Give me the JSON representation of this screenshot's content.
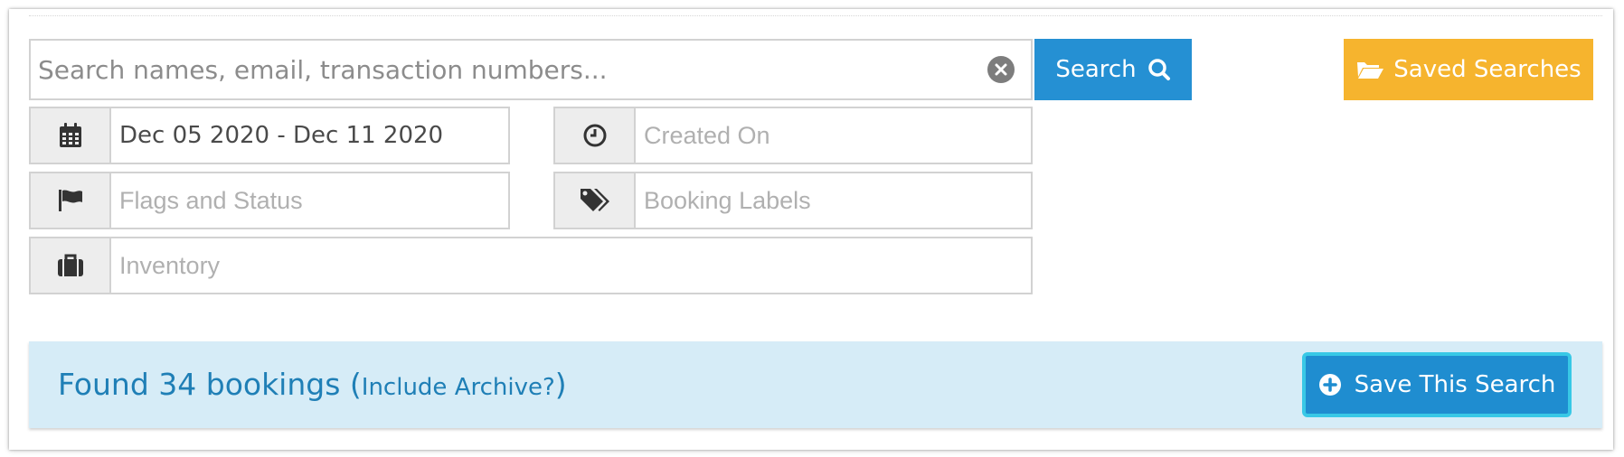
{
  "search": {
    "placeholder": "Search names, email, transaction numbers...",
    "value": "",
    "button_label": "Search"
  },
  "saved_searches": {
    "label": "Saved Searches"
  },
  "filters": {
    "date_range": {
      "icon": "calendar-icon",
      "value": "Dec 05 2020 - Dec 11 2020"
    },
    "created_on": {
      "icon": "clock-icon",
      "placeholder": "Created On"
    },
    "flags_status": {
      "icon": "flag-icon",
      "placeholder": "Flags and Status"
    },
    "booking_labels": {
      "icon": "tags-icon",
      "placeholder": "Booking Labels"
    },
    "inventory": {
      "icon": "briefcase-icon",
      "placeholder": "Inventory"
    }
  },
  "results": {
    "found_text": "Found 34 bookings",
    "open_paren": "(",
    "archive_link": "Include Archive?",
    "close_paren": ")",
    "save_button_label": "Save This Search"
  },
  "colors": {
    "search_button": "#2590d3",
    "saved_searches_button": "#f6b42e",
    "results_bar": "#d6ecf7",
    "results_text": "#1f7fb6",
    "save_button_border": "#38c8e6"
  }
}
